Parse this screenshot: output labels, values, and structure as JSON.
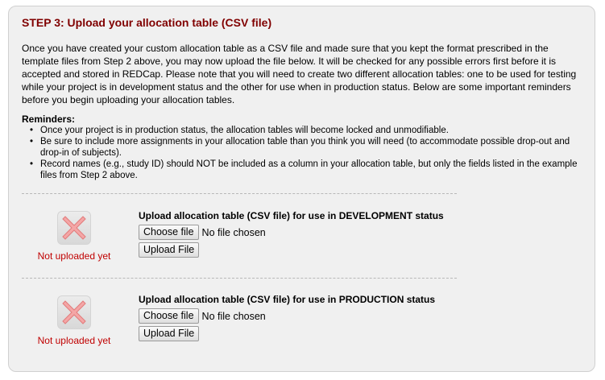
{
  "step": {
    "title": "STEP 3: Upload your allocation table (CSV file)",
    "intro": "Once you have created your custom allocation table as a CSV file and made sure that you kept the format prescribed in the template files from Step 2 above, you may now upload the file below. It will be checked for any possible errors first before it is accepted and stored in REDCap. Please note that you will need to create two different allocation tables: one to be used for testing while your project is in development status and the other for use when in production status. Below are some important reminders before you begin uploading your allocation tables."
  },
  "reminders": {
    "title": "Reminders:",
    "items": [
      "Once your project is in production status, the allocation tables will become locked and unmodifiable.",
      "Be sure to include more assignments in your allocation table than you think you will need (to accommodate possible drop-out and drop-in of subjects).",
      "Record names (e.g., study ID) should NOT be included as a column in your allocation table, but only the fields listed in the example files from Step 2 above."
    ]
  },
  "uploads": [
    {
      "status_text": "Not uploaded yet",
      "status_icon": "red-x-icon",
      "label": "Upload allocation table (CSV file) for use in DEVELOPMENT status",
      "choose_label": "Choose file",
      "file_status": "No file chosen",
      "upload_label": "Upload File"
    },
    {
      "status_text": "Not uploaded yet",
      "status_icon": "red-x-icon",
      "label": "Upload allocation table (CSV file) for use in PRODUCTION status",
      "choose_label": "Choose file",
      "file_status": "No file chosen",
      "upload_label": "Upload File"
    }
  ],
  "colors": {
    "title": "#800000",
    "status_text": "#c00000",
    "panel_bg": "#f0f0f0",
    "x_icon": "#f08a8a"
  }
}
